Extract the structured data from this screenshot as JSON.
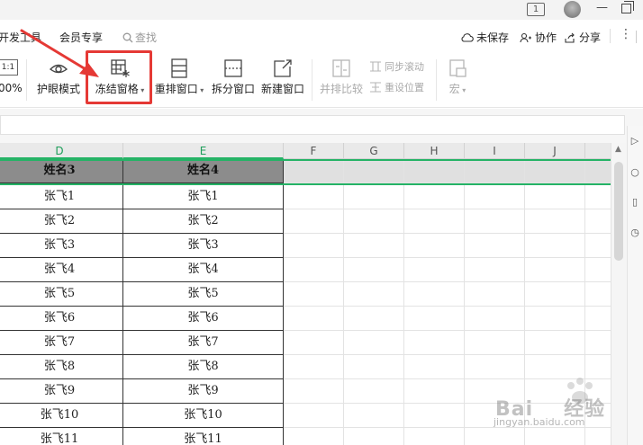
{
  "top_bar": {
    "page_indicator": "1",
    "avatar": "avatar",
    "restore_icon": "restore-window-icon"
  },
  "menu": {
    "items": [
      "开发工具",
      "会员专享"
    ],
    "search_label": "查找",
    "right_actions": [
      {
        "label": "未保存",
        "icon": "cloud-icon"
      },
      {
        "label": "协作",
        "icon": "collab-icon"
      },
      {
        "label": "分享",
        "icon": "share-icon"
      }
    ],
    "more": "⋮"
  },
  "ribbon": {
    "zoom_box": "1:1",
    "zoom_percent": "00%",
    "buttons": [
      {
        "label": "护眼模式",
        "icon": "eye-icon"
      },
      {
        "label": "冻结窗格",
        "icon": "freeze-panes-icon",
        "dropdown": true
      },
      {
        "label": "重排窗口",
        "icon": "arrange-windows-icon",
        "dropdown": true
      },
      {
        "label": "拆分窗口",
        "icon": "split-window-icon"
      },
      {
        "label": "新建窗口",
        "icon": "new-window-icon"
      },
      {
        "label": "并排比较",
        "icon": "side-by-side-icon",
        "disabled": true
      }
    ],
    "small_buttons": [
      {
        "label": "同步滚动",
        "icon": "sync-scroll-icon"
      },
      {
        "label": "重设位置",
        "icon": "reset-position-icon"
      }
    ],
    "macro_label": "宏",
    "accent_color": "#e53935"
  },
  "sheet": {
    "columns": [
      "D",
      "E",
      "F",
      "G",
      "H",
      "I",
      "J"
    ],
    "header_row": [
      "姓名3",
      "姓名4"
    ],
    "rows": [
      [
        "张飞1",
        "张飞1"
      ],
      [
        "张飞2",
        "张飞2"
      ],
      [
        "张飞3",
        "张飞3"
      ],
      [
        "张飞4",
        "张飞4"
      ],
      [
        "张飞5",
        "张飞5"
      ],
      [
        "张飞6",
        "张飞6"
      ],
      [
        "张飞7",
        "张飞7"
      ],
      [
        "张飞8",
        "张飞8"
      ],
      [
        "张飞9",
        "张飞9"
      ],
      [
        "张飞10",
        "张飞10"
      ],
      [
        "张飞11",
        "张飞11"
      ]
    ],
    "freeze_color": "#25b366"
  },
  "watermark": {
    "brand": "Bai",
    "brand_suffix": "经验",
    "url": "jingyan.baidu.com"
  }
}
